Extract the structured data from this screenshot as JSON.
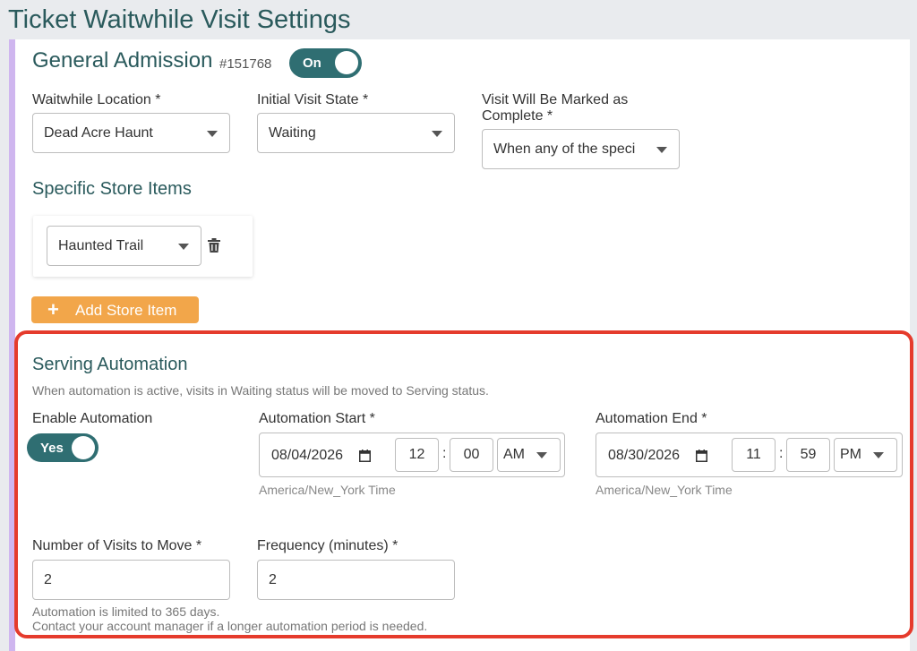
{
  "page_title": "Ticket Waitwhile Visit Settings",
  "general": {
    "title": "General Admission",
    "id": "#151768",
    "toggle_label": "On",
    "location_label": "Waitwhile Location *",
    "location_value": "Dead Acre Haunt",
    "initial_state_label": "Initial Visit State *",
    "initial_state_value": "Waiting",
    "complete_label": "Visit Will Be Marked as Complete *",
    "complete_value": "When any of the speci"
  },
  "store_items": {
    "title": "Specific Store Items",
    "items": [
      {
        "value": "Haunted Trail"
      }
    ],
    "add_button": "Add Store Item"
  },
  "automation": {
    "title": "Serving Automation",
    "description": "When automation is active, visits in Waiting status will be moved to Serving status.",
    "enable_label": "Enable Automation",
    "enable_toggle": "Yes",
    "start_label": "Automation Start *",
    "start_date": "08/04/2026",
    "start_hour": "12",
    "start_minute": "00",
    "start_ampm": "AM",
    "start_tz": "America/New_York Time",
    "end_label": "Automation End *",
    "end_date": "08/30/2026",
    "end_hour": "11",
    "end_minute": "59",
    "end_ampm": "PM",
    "end_tz": "America/New_York Time",
    "visits_label": "Number of Visits to Move *",
    "visits_value": "2",
    "frequency_label": "Frequency (minutes) *",
    "frequency_value": "2",
    "limit_note_1": "Automation is limited to 365 days.",
    "limit_note_2": "Contact your account manager if a longer automation period is needed."
  },
  "colors": {
    "accent_teal": "#2f6e72",
    "title_teal": "#2a5a5c",
    "orange": "#f2a64a",
    "highlight_red": "#e53b2c",
    "left_bar": "#cfb6ef"
  },
  "icons": [
    "trash-icon",
    "calendar-icon",
    "chevron-down-icon",
    "plus-icon"
  ]
}
